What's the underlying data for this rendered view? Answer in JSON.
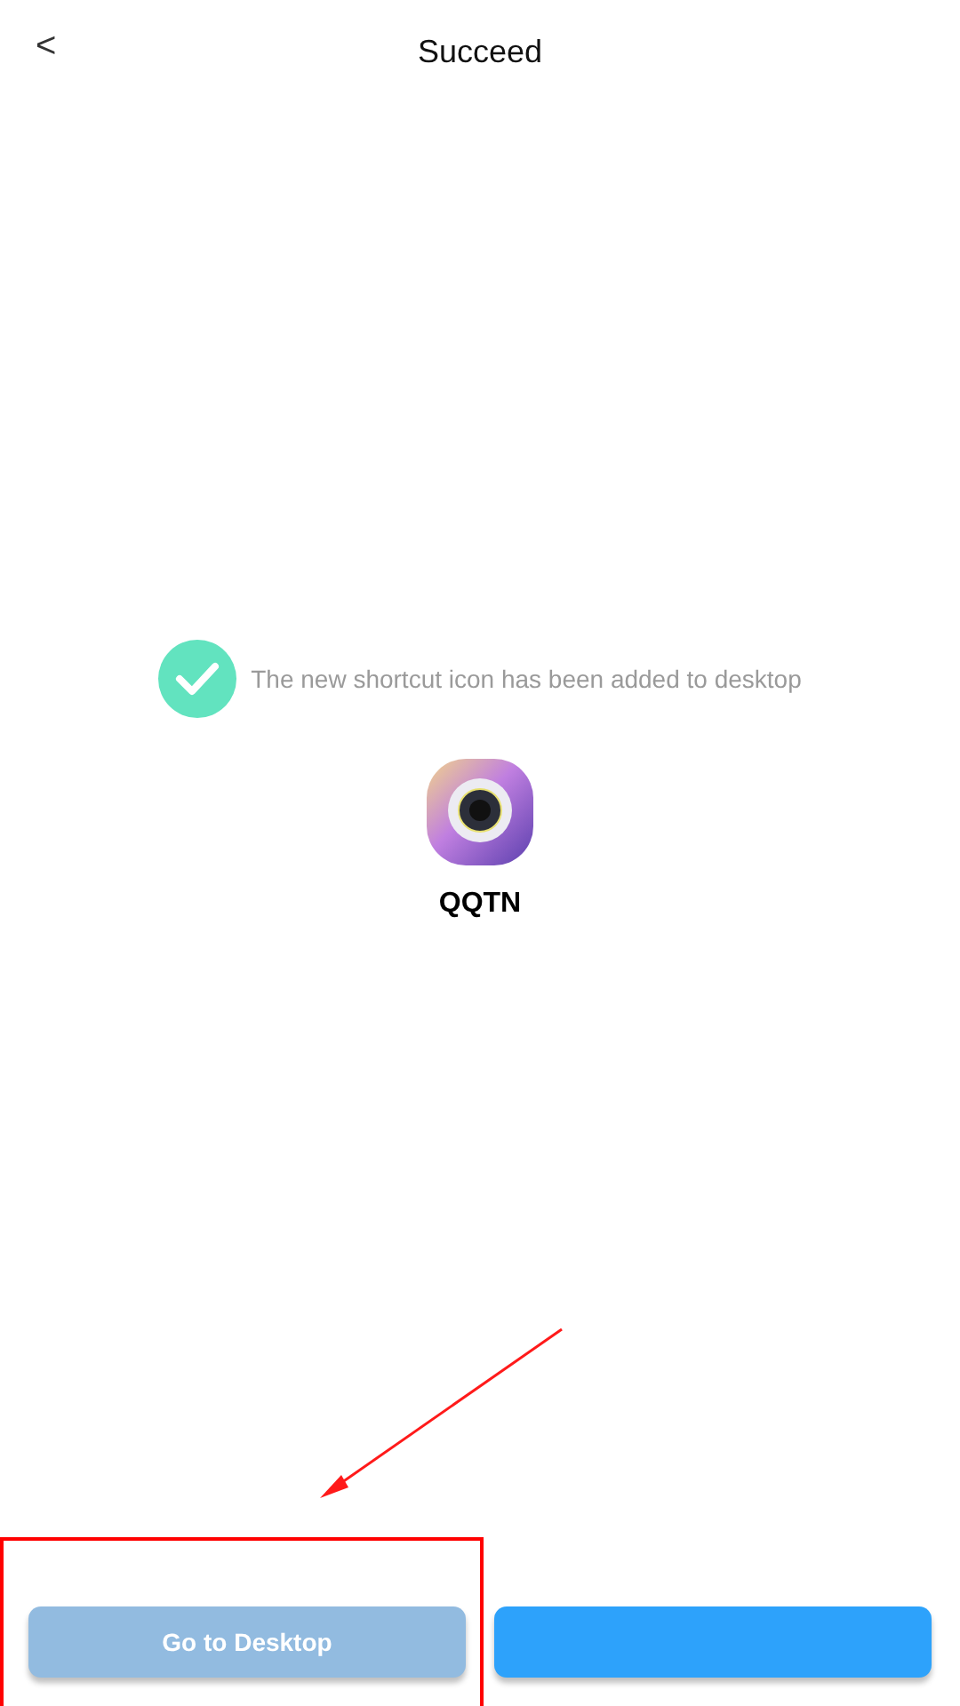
{
  "header": {
    "back": "<",
    "title": "Succeed"
  },
  "message": "The new shortcut icon has been added to desktop",
  "app": {
    "name": "QQTN"
  },
  "buttons": [
    {
      "label": "Go to Desktop",
      "kind": "primary"
    },
    {
      "kind": "secondary"
    }
  ]
}
